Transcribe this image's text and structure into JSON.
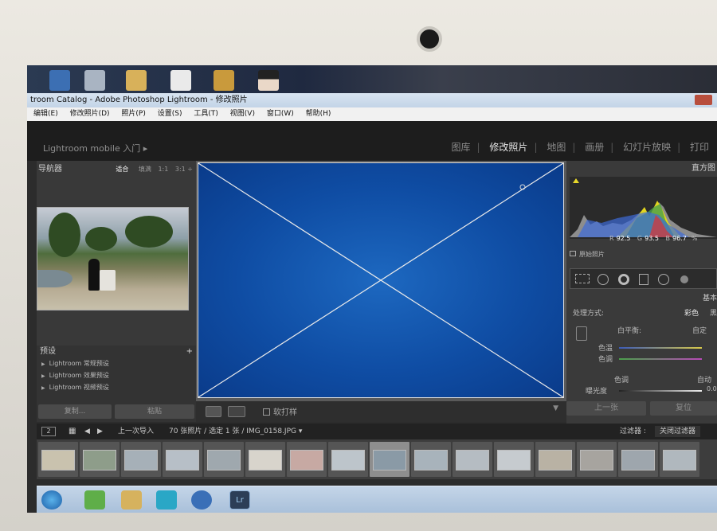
{
  "window": {
    "title": "troom Catalog - Adobe Photoshop Lightroom - 修改照片"
  },
  "menu": [
    "编辑(E)",
    "修改照片(D)",
    "照片(P)",
    "设置(S)",
    "工具(T)",
    "视图(V)",
    "窗口(W)",
    "帮助(H)"
  ],
  "header": {
    "mobile": "Lightroom mobile 入门 ▸",
    "modules": [
      "图库",
      "修改照片",
      "地图",
      "画册",
      "幻灯片放映",
      "打印"
    ],
    "active_module": "修改照片"
  },
  "navigator": {
    "title": "导航器",
    "zoom": [
      "适合",
      "填满",
      "1:1",
      "3:1 ÷"
    ]
  },
  "presets": {
    "title": "预设",
    "add": "+",
    "items": [
      "Lightroom 常规预设",
      "Lightroom 效果预设",
      "Lightroom 视频预设"
    ]
  },
  "left_buttons": {
    "copy": "复制...",
    "paste": "粘贴"
  },
  "toolbar": {
    "soft_proof": "软打样"
  },
  "histogram": {
    "title": "直方图",
    "r_label": "R",
    "r": "92.5",
    "g_label": "G",
    "g": "93.5",
    "b_label": "B",
    "b": "96.7",
    "pct": "%",
    "original_photo": "原始照片"
  },
  "basic": {
    "title": "基本",
    "treatment_label": "处理方式:",
    "treatment_color": "彩色",
    "treatment_bw": "黑",
    "wb_label": "白平衡:",
    "wb_value": "自定",
    "temp": "色温",
    "tint": "色调",
    "tone_label": "色调",
    "tone_auto": "自动",
    "exposure": "曝光度",
    "exposure_val": "0.0"
  },
  "right_buttons": {
    "prev": "上一张",
    "reset": "复位"
  },
  "filmstrip_bar": {
    "page": "2",
    "source": "上一次导入",
    "count": "70 张照片 / 选定 1 张 / IMG_0158.JPG ▾",
    "filter_label": "过滤器 :",
    "filter_value": "关闭过滤器"
  },
  "taskbar": {
    "lr_label": "Lr"
  },
  "colors": {
    "blue": "#0f4da4",
    "panel": "#3a3a3a",
    "accent": "#c8c8c8"
  }
}
